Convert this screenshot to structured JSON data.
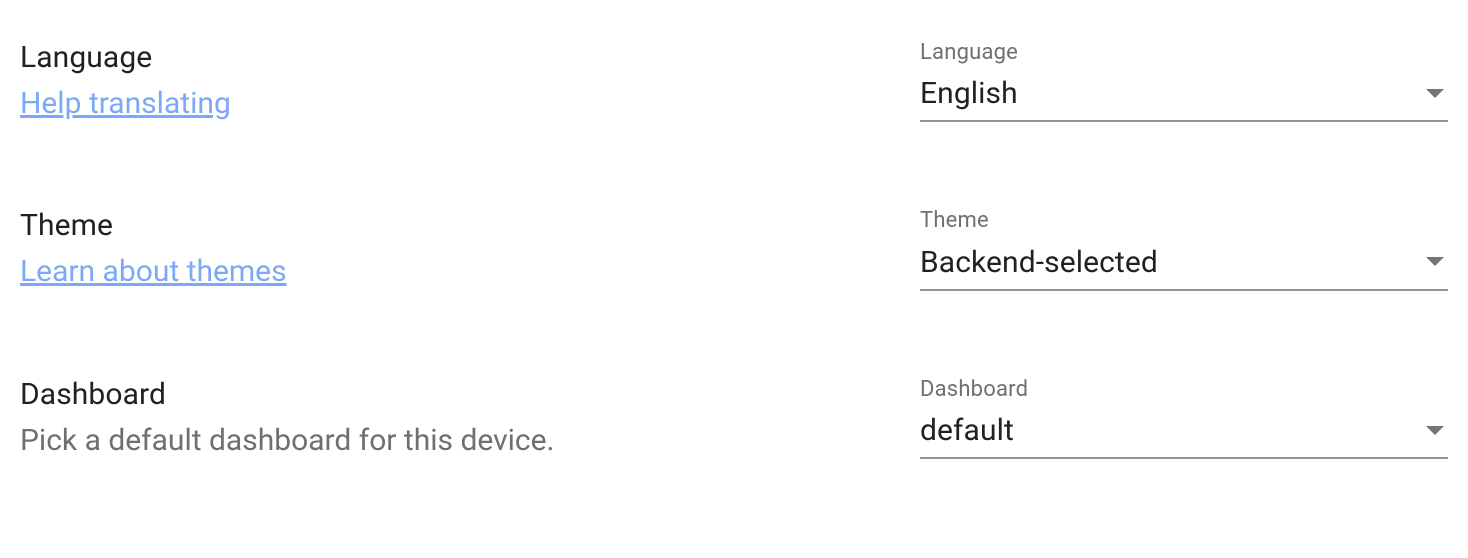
{
  "rows": [
    {
      "title": "Language",
      "link": "Help translating",
      "field_label": "Language",
      "field_value": "English"
    },
    {
      "title": "Theme",
      "link": "Learn about themes",
      "field_label": "Theme",
      "field_value": "Backend-selected"
    },
    {
      "title": "Dashboard",
      "desc": "Pick a default dashboard for this device.",
      "field_label": "Dashboard",
      "field_value": "default"
    }
  ]
}
